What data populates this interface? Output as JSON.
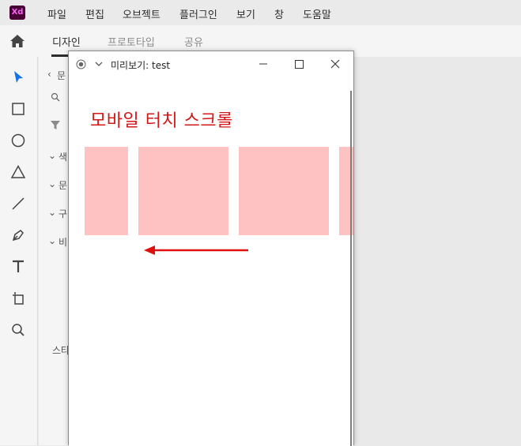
{
  "app": {
    "logo_text": "Xd",
    "menu": [
      "파일",
      "편집",
      "오브젝트",
      "플러그인",
      "보기",
      "창",
      "도움말"
    ]
  },
  "tabs": {
    "design": "디자인",
    "prototype": "프로토타입",
    "share": "공유"
  },
  "tools": [
    "select-icon",
    "rectangle-icon",
    "ellipse-icon",
    "triangle-icon",
    "line-icon",
    "pen-icon",
    "text-icon",
    "artboard-icon",
    "zoom-icon"
  ],
  "left_panel": {
    "back_label": "문",
    "search_char": "",
    "sections": [
      "색",
      "문",
      "구",
      "비"
    ],
    "footer_label": "스타"
  },
  "preview_window": {
    "title": "미리보기: test",
    "heading": "모바일 터치 스크롤",
    "card_color": "#ffc2c2",
    "heading_color": "#d31818",
    "arrow_color": "#e01010"
  },
  "colors": {
    "accent_select": "#1473e6",
    "logo_bg": "#470137",
    "logo_fg": "#ff61f6"
  }
}
